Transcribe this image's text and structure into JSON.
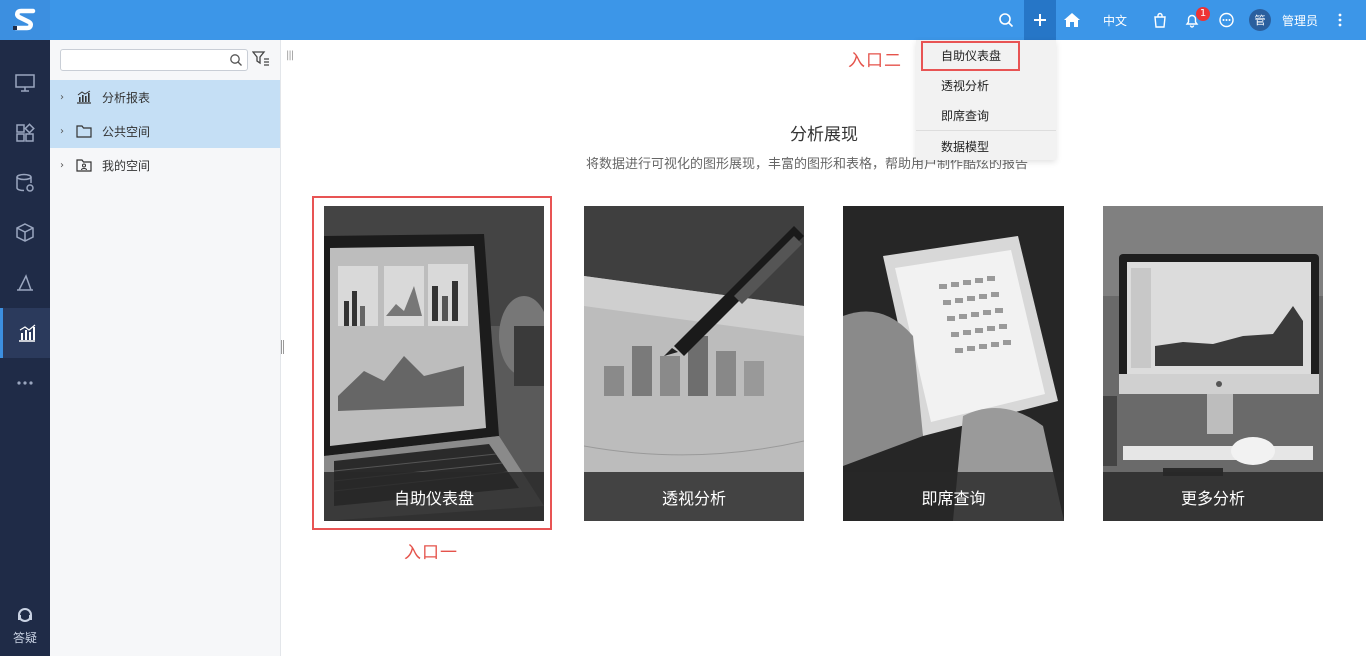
{
  "topbar": {
    "language": "中文",
    "notification_count": "1",
    "avatar_text": "管",
    "username": "管理员"
  },
  "rail": {
    "help_label": "答疑"
  },
  "tree": {
    "search_placeholder": "",
    "nodes": [
      {
        "label": "分析报表",
        "icon": "chart-icon",
        "selected": true
      },
      {
        "label": "公共空间",
        "icon": "folder-icon",
        "selected": true
      },
      {
        "label": "我的空间",
        "icon": "personal-folder-icon",
        "selected": false
      }
    ]
  },
  "main": {
    "title": "分析展现",
    "subtitle": "将数据进行可视化的图形展现，丰富的图形和表格，帮助用户制作酷炫的报告",
    "cards": [
      {
        "label": "自助仪表盘"
      },
      {
        "label": "透视分析"
      },
      {
        "label": "即席查询"
      },
      {
        "label": "更多分析"
      }
    ]
  },
  "dropdown": {
    "items": [
      "自助仪表盘",
      "透视分析",
      "即席查询",
      "数据模型"
    ]
  },
  "annotations": {
    "entry_two": "入口二",
    "entry_one": "入口一"
  },
  "colors": {
    "topbar": "#3c96e8",
    "rail": "#1f2b47",
    "highlight": "#e85454"
  }
}
